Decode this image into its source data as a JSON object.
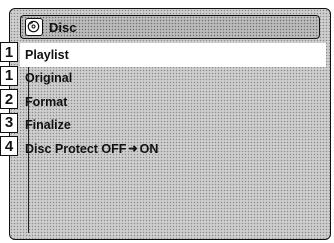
{
  "header": {
    "title": "Disc",
    "icon": "disc-icon"
  },
  "menu": {
    "items": [
      {
        "badge": "1",
        "label": "Playlist",
        "selected": true
      },
      {
        "badge": "1",
        "label": "Original",
        "selected": false
      },
      {
        "badge": "2",
        "label": "Format",
        "selected": false
      },
      {
        "badge": "3",
        "label": "Finalize",
        "selected": false
      },
      {
        "badge": "4",
        "label_prefix": "Disc Protect OFF",
        "arrow_icon": "right-arrow-icon",
        "label_suffix": "ON",
        "selected": false
      }
    ]
  }
}
